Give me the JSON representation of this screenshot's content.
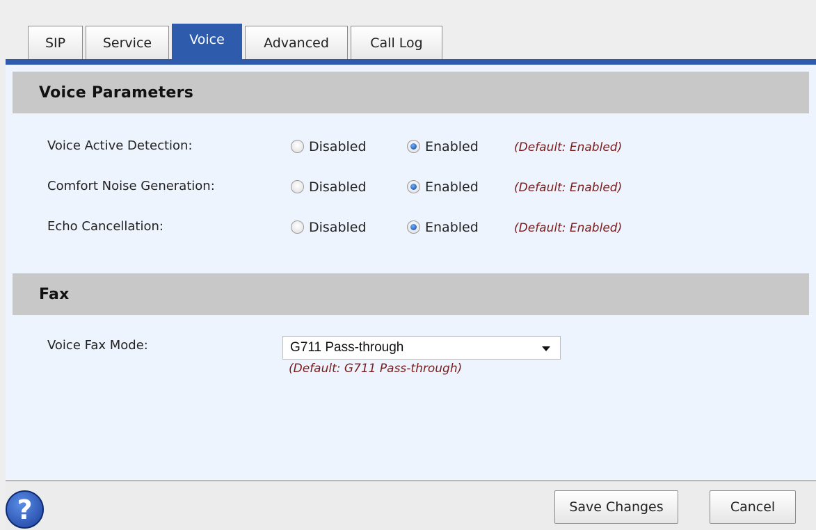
{
  "tabs": [
    {
      "label": "SIP"
    },
    {
      "label": "Service"
    },
    {
      "label": "Voice"
    },
    {
      "label": "Advanced"
    },
    {
      "label": "Call Log"
    }
  ],
  "active_tab": "Voice",
  "voice_section": {
    "title": "Voice Parameters",
    "rows": [
      {
        "label": "Voice Active Detection:",
        "option_disabled": "Disabled",
        "option_enabled": "Enabled",
        "selected": "Enabled",
        "default_note": "(Default: Enabled)"
      },
      {
        "label": "Comfort Noise Generation:",
        "option_disabled": "Disabled",
        "option_enabled": "Enabled",
        "selected": "Enabled",
        "default_note": "(Default: Enabled)"
      },
      {
        "label": "Echo Cancellation:",
        "option_disabled": "Disabled",
        "option_enabled": "Enabled",
        "selected": "Enabled",
        "default_note": "(Default: Enabled)"
      }
    ]
  },
  "fax_section": {
    "title": "Fax",
    "mode_label": "Voice Fax Mode:",
    "mode_value": "G711 Pass-through",
    "mode_default_note": "(Default: G711 Pass-through)"
  },
  "footer": {
    "help_icon": "?",
    "save_label": "Save Changes",
    "cancel_label": "Cancel"
  },
  "colors": {
    "accent_blue": "#2f5bac",
    "panel_bg": "#edf4fd",
    "section_header_bg": "#c8c8c8",
    "default_note": "#7a1b1b"
  }
}
